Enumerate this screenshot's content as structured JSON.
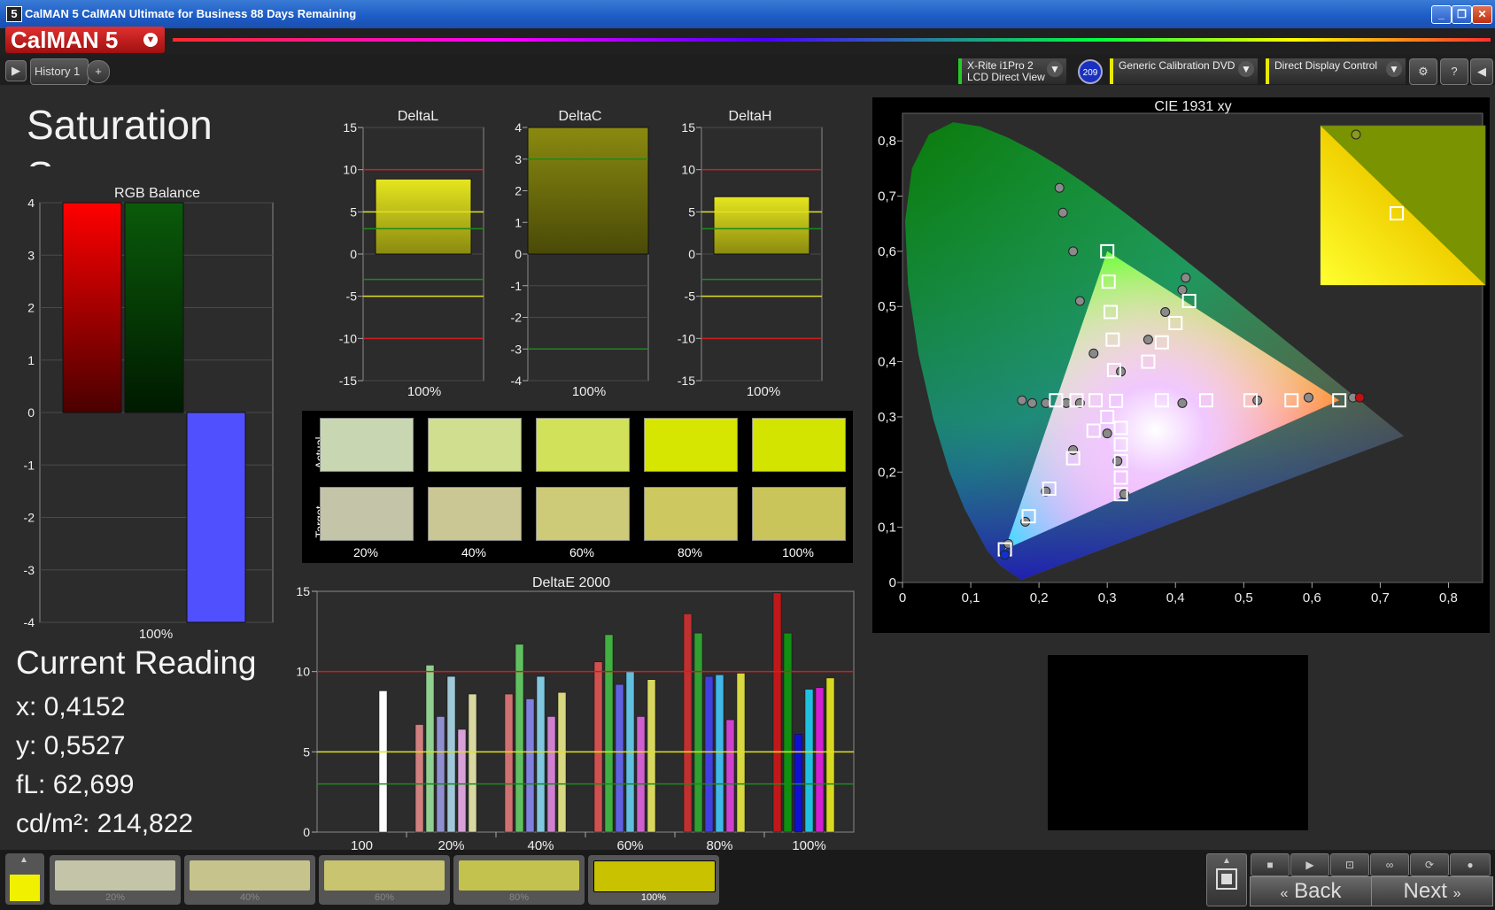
{
  "window": {
    "title": "CalMAN 5 CalMAN Ultimate for Business 88 Days Remaining",
    "app_icon": "5",
    "min": "_",
    "max": "❐",
    "close": "✕"
  },
  "app": {
    "logo": "CalMAN 5"
  },
  "toolbar": {
    "tab": "History 1",
    "add_tab": "+",
    "meter": {
      "line1": "X-Rite i1Pro 2",
      "line2": "LCD Direct View",
      "color": "#22cc22"
    },
    "meter_badge": "209",
    "source": {
      "label": "Generic Calibration DVD",
      "color": "#e8e800"
    },
    "display": {
      "label": "Direct Display Control",
      "color": "#e8e800"
    },
    "icons": [
      "gear-icon",
      "help-icon",
      "collapse-icon"
    ]
  },
  "page": {
    "title": "Saturation Sweeps"
  },
  "rgb_balance": {
    "title": "RGB Balance",
    "yticks": [
      "4",
      "3",
      "2",
      "1",
      "0",
      "-1",
      "-2",
      "-3",
      "-4"
    ],
    "xlabel": "100%"
  },
  "delta_charts": [
    {
      "title": "DeltaL",
      "yticks": [
        "15",
        "10",
        "5",
        "0",
        "-5",
        "-10",
        "-15"
      ],
      "xlabel": "100%"
    },
    {
      "title": "DeltaC",
      "yticks": [
        "4",
        "3",
        "2",
        "1",
        "0",
        "-1",
        "-2",
        "-3",
        "-4"
      ],
      "xlabel": "100%"
    },
    {
      "title": "DeltaH",
      "yticks": [
        "15",
        "10",
        "5",
        "0",
        "-5",
        "-10",
        "-15"
      ],
      "xlabel": "100%"
    }
  ],
  "swatches": {
    "row_labels": [
      "Actual",
      "Target"
    ],
    "labels": [
      "20%",
      "40%",
      "60%",
      "80%",
      "100%"
    ],
    "actual": [
      "#c9d6b2",
      "#d0de90",
      "#d2e15a",
      "#d6e600",
      "#d2e400"
    ],
    "target": [
      "#c4c4a8",
      "#cac794",
      "#cdca78",
      "#cdc860",
      "#cac55a"
    ]
  },
  "deltae": {
    "title": "DeltaE 2000",
    "yticks": [
      "15",
      "10",
      "5",
      "0"
    ],
    "xlabels": [
      "100",
      "20%",
      "40%",
      "60%",
      "80%",
      "100%"
    ]
  },
  "cie": {
    "title": "CIE 1931 xy",
    "xticks": [
      "0",
      "0,1",
      "0,2",
      "0,3",
      "0,4",
      "0,5",
      "0,6",
      "0,7",
      "0,8"
    ],
    "yticks": [
      "0",
      "0,1",
      "0,2",
      "0,3",
      "0,4",
      "0,5",
      "0,6",
      "0,7",
      "0,8"
    ]
  },
  "reading": {
    "heading": "Current Reading",
    "x": "x: 0,4152",
    "y": "y: 0,5527",
    "fl": "fL: 62,699",
    "cd": "cd/m²: 214,822"
  },
  "bottom": {
    "current_color": "#f0f000",
    "swatches": [
      {
        "label": "20%",
        "color": "#c4c4a8"
      },
      {
        "label": "40%",
        "color": "#c6c48c"
      },
      {
        "label": "60%",
        "color": "#c8c470"
      },
      {
        "label": "80%",
        "color": "#c4c24e"
      },
      {
        "label": "100%",
        "color": "#c8c200"
      }
    ],
    "back": "Back",
    "next": "Next"
  },
  "chart_data": [
    {
      "type": "bar",
      "title": "RGB Balance",
      "categories": [
        "100%"
      ],
      "series": [
        {
          "values": [
            4.0
          ],
          "color": "#cc0000"
        },
        {
          "values": [
            4.0
          ],
          "color": "#0a5a0a"
        },
        {
          "values": [
            -4.0
          ],
          "color": "#5050ff"
        }
      ],
      "ylim": [
        -4,
        4
      ]
    },
    {
      "type": "bar",
      "title": "DeltaL",
      "categories": [
        "100%"
      ],
      "values": [
        8.9
      ],
      "ylim": [
        -15,
        15
      ]
    },
    {
      "type": "bar",
      "title": "DeltaC",
      "categories": [
        "100%"
      ],
      "values": [
        4.0
      ],
      "ylim": [
        -4,
        4
      ]
    },
    {
      "type": "bar",
      "title": "DeltaH",
      "categories": [
        "100%"
      ],
      "values": [
        6.8
      ],
      "ylim": [
        -15,
        15
      ]
    },
    {
      "type": "bar",
      "title": "DeltaE 2000",
      "categories": [
        "100",
        "20%",
        "40%",
        "60%",
        "80%",
        "100%"
      ],
      "groups": [
        [
          {
            "v": 8.8,
            "c": "#ffffff"
          }
        ],
        [
          {
            "v": 6.7,
            "c": "#d08080"
          },
          {
            "v": 10.4,
            "c": "#90d090"
          },
          {
            "v": 7.2,
            "c": "#9090d0"
          },
          {
            "v": 9.7,
            "c": "#a0c8d8"
          },
          {
            "v": 6.4,
            "c": "#d8a0d8"
          },
          {
            "v": 8.6,
            "c": "#d8d8a0"
          }
        ],
        [
          {
            "v": 8.6,
            "c": "#d07070"
          },
          {
            "v": 11.7,
            "c": "#60c060"
          },
          {
            "v": 8.3,
            "c": "#8080e0"
          },
          {
            "v": 9.7,
            "c": "#80c8e0"
          },
          {
            "v": 7.2,
            "c": "#d080d0"
          },
          {
            "v": 8.7,
            "c": "#d8d880"
          }
        ],
        [
          {
            "v": 10.6,
            "c": "#d05050"
          },
          {
            "v": 12.3,
            "c": "#40b040"
          },
          {
            "v": 9.2,
            "c": "#6060e0"
          },
          {
            "v": 10.0,
            "c": "#60c0e0"
          },
          {
            "v": 7.2,
            "c": "#d060d0"
          },
          {
            "v": 9.5,
            "c": "#d8d860"
          }
        ],
        [
          {
            "v": 13.6,
            "c": "#c03030"
          },
          {
            "v": 12.4,
            "c": "#30a030"
          },
          {
            "v": 9.7,
            "c": "#4040e0"
          },
          {
            "v": 9.8,
            "c": "#40b8e8"
          },
          {
            "v": 7.0,
            "c": "#d040d0"
          },
          {
            "v": 9.9,
            "c": "#d8d840"
          }
        ],
        [
          {
            "v": 14.9,
            "c": "#c01818"
          },
          {
            "v": 12.4,
            "c": "#109010"
          },
          {
            "v": 6.1,
            "c": "#1010d0"
          },
          {
            "v": 8.9,
            "c": "#20c0e0"
          },
          {
            "v": 9.0,
            "c": "#d020d0"
          },
          {
            "v": 9.6,
            "c": "#d8d820"
          }
        ]
      ],
      "ylim": [
        0,
        15
      ]
    },
    {
      "type": "scatter",
      "title": "CIE 1931 xy",
      "xlim": [
        0,
        0.85
      ],
      "ylim": [
        0,
        0.85
      ],
      "gamut_triangle": [
        [
          0.64,
          0.33
        ],
        [
          0.3,
          0.6
        ],
        [
          0.15,
          0.06
        ]
      ],
      "targets": [
        [
          0.313,
          0.329
        ],
        [
          0.3,
          0.6
        ],
        [
          0.302,
          0.545
        ],
        [
          0.305,
          0.49
        ],
        [
          0.308,
          0.44
        ],
        [
          0.31,
          0.385
        ],
        [
          0.42,
          0.51
        ],
        [
          0.4,
          0.47
        ],
        [
          0.38,
          0.435
        ],
        [
          0.36,
          0.4
        ],
        [
          0.64,
          0.33
        ],
        [
          0.57,
          0.33
        ],
        [
          0.51,
          0.33
        ],
        [
          0.445,
          0.33
        ],
        [
          0.38,
          0.33
        ],
        [
          0.15,
          0.06
        ],
        [
          0.185,
          0.12
        ],
        [
          0.215,
          0.17
        ],
        [
          0.25,
          0.225
        ],
        [
          0.28,
          0.275
        ],
        [
          0.3,
          0.3
        ],
        [
          0.32,
          0.28
        ],
        [
          0.32,
          0.25
        ],
        [
          0.32,
          0.22
        ],
        [
          0.32,
          0.19
        ],
        [
          0.32,
          0.16
        ],
        [
          0.225,
          0.33
        ],
        [
          0.255,
          0.33
        ],
        [
          0.283,
          0.33
        ]
      ],
      "measured": [
        [
          0.23,
          0.715
        ],
        [
          0.235,
          0.67
        ],
        [
          0.25,
          0.6
        ],
        [
          0.26,
          0.51
        ],
        [
          0.28,
          0.415
        ],
        [
          0.32,
          0.382
        ],
        [
          0.415,
          0.552
        ],
        [
          0.41,
          0.53
        ],
        [
          0.385,
          0.49
        ],
        [
          0.36,
          0.44
        ],
        [
          0.66,
          0.335
        ],
        [
          0.595,
          0.335
        ],
        [
          0.52,
          0.33
        ],
        [
          0.41,
          0.325
        ],
        [
          0.175,
          0.33
        ],
        [
          0.19,
          0.325
        ],
        [
          0.21,
          0.325
        ],
        [
          0.24,
          0.325
        ],
        [
          0.26,
          0.325
        ],
        [
          0.155,
          0.07
        ],
        [
          0.18,
          0.11
        ],
        [
          0.21,
          0.165
        ],
        [
          0.25,
          0.24
        ],
        [
          0.3,
          0.27
        ],
        [
          0.315,
          0.22
        ],
        [
          0.325,
          0.16
        ]
      ]
    }
  ]
}
